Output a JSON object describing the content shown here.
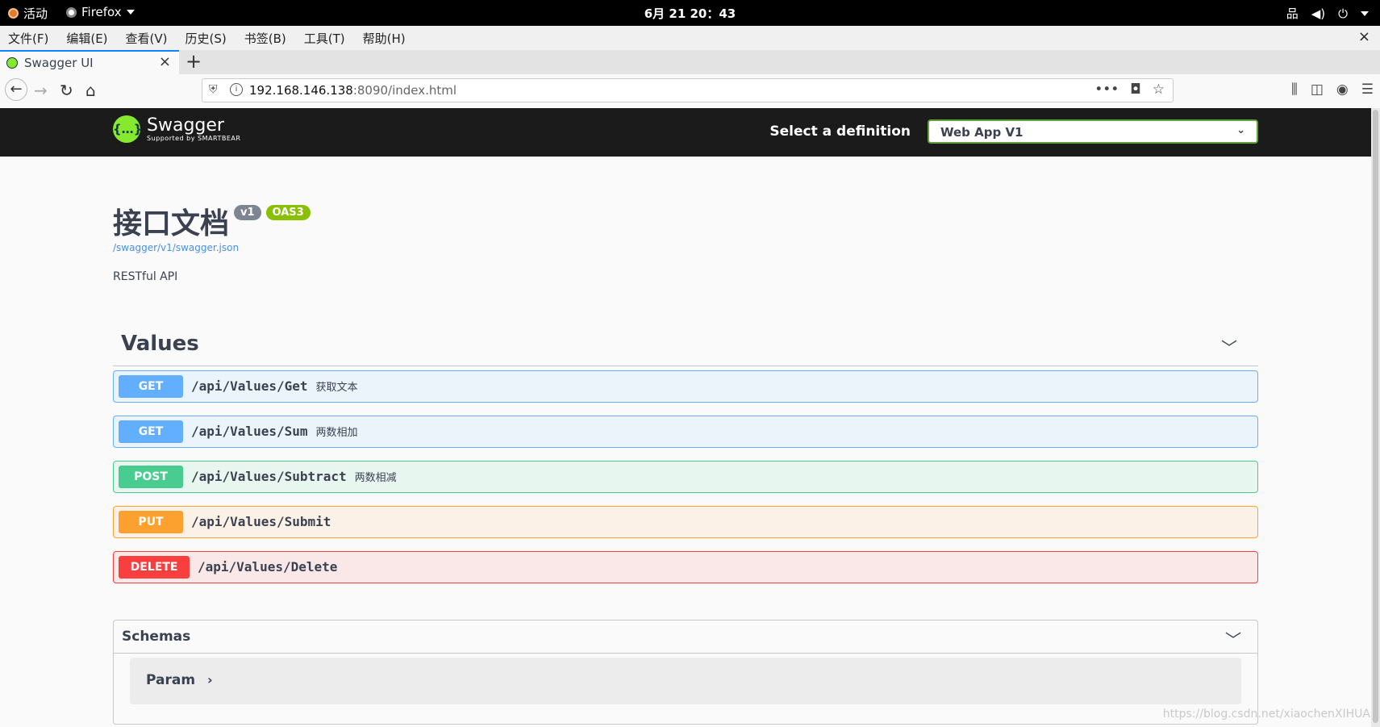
{
  "system": {
    "activities": "活动",
    "app_name": "Firefox",
    "clock": "6月 21  20：43"
  },
  "menubar": {
    "items": [
      "文件(F)",
      "编辑(E)",
      "查看(V)",
      "历史(S)",
      "书签(B)",
      "工具(T)",
      "帮助(H)"
    ],
    "close": "×"
  },
  "browser": {
    "tab_title": "Swagger UI",
    "tab_close": "×",
    "new_tab": "+",
    "url_host": "192.168.146.138",
    "url_rest": ":8090/index.html",
    "page_actions": "•••"
  },
  "swagger": {
    "logo_name": "Swagger",
    "logo_sub": "Supported by SMARTBEAR",
    "select_label": "Select a definition",
    "selected_definition": "Web App V1",
    "title": "接口文档",
    "version_badge": "v1",
    "oas_badge": "OAS3",
    "spec_link": "/swagger/v1/swagger.json",
    "description": "RESTful API",
    "tag": "Values",
    "operations": [
      {
        "method": "GET",
        "path": "/api/Values/Get",
        "summary": "获取文本"
      },
      {
        "method": "GET",
        "path": "/api/Values/Sum",
        "summary": "两数相加"
      },
      {
        "method": "POST",
        "path": "/api/Values/Subtract",
        "summary": "两数相减"
      },
      {
        "method": "PUT",
        "path": "/api/Values/Submit",
        "summary": ""
      },
      {
        "method": "DELETE",
        "path": "/api/Values/Delete",
        "summary": ""
      }
    ],
    "schemas_title": "Schemas",
    "models": [
      "Param"
    ]
  },
  "watermark": "https://blog.csdn.net/xiaochenXIHUA",
  "colors": {
    "get": "#61affe",
    "post": "#49cc90",
    "put": "#fca130",
    "delete": "#f93e3e",
    "header_bg": "#1b1b1b",
    "swagger_green": "#85ea2d"
  }
}
